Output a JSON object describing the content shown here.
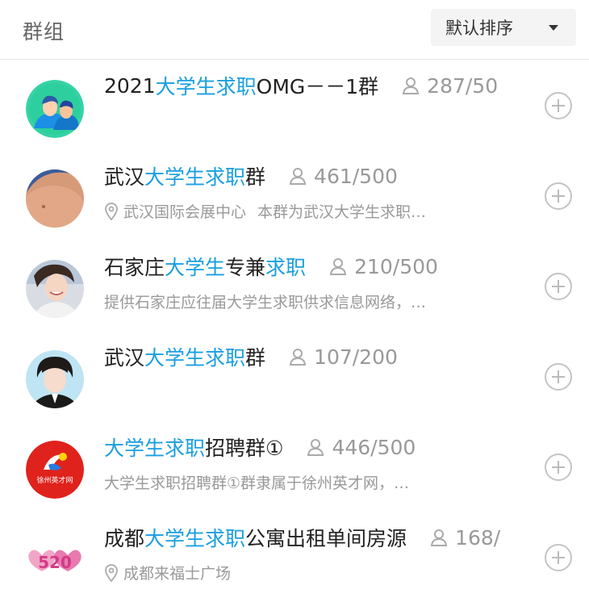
{
  "header": {
    "title": "群组",
    "sort_label": "默认排序"
  },
  "groups": [
    {
      "name_parts": [
        "2021",
        "大学生求职",
        "OMG－－1群"
      ],
      "members": "287/50",
      "desc": null,
      "avatar": "cartoon-couple"
    },
    {
      "name_parts": [
        "武汉",
        "大学生求职",
        "群"
      ],
      "members": "461/500",
      "location": "武汉国际会展中心",
      "desc": "本群为武汉大学生求职…",
      "avatar": "photo-skin"
    },
    {
      "name_parts": [
        "石家庄",
        "大学生",
        "专兼",
        "求职"
      ],
      "members": "210/500",
      "desc": "提供石家庄应往届大学生求职供求信息网络，…",
      "avatar": "photo-person"
    },
    {
      "name_parts": [
        "武汉",
        "大学生求职",
        "群"
      ],
      "members": "107/200",
      "desc": null,
      "avatar": "photo-suit"
    },
    {
      "name_parts": [
        "",
        "大学生求职",
        "招聘群①"
      ],
      "members": "446/500",
      "desc": "大学生求职招聘群①群隶属于徐州英才网，…",
      "avatar": "logo-xuzhou",
      "logo_text": "徐州英才网"
    },
    {
      "name_parts": [
        "成都",
        "大学生求职",
        "公寓出租单间房源"
      ],
      "members": "168/",
      "location": "成都来福士广场",
      "avatar": "graphic-520",
      "logo_text": "520"
    }
  ],
  "colors": {
    "highlight": "#1a9fe0",
    "muted": "#999999"
  },
  "icons": [
    "caret-down-icon",
    "person-icon",
    "location-pin-icon",
    "plus-circle-icon"
  ]
}
